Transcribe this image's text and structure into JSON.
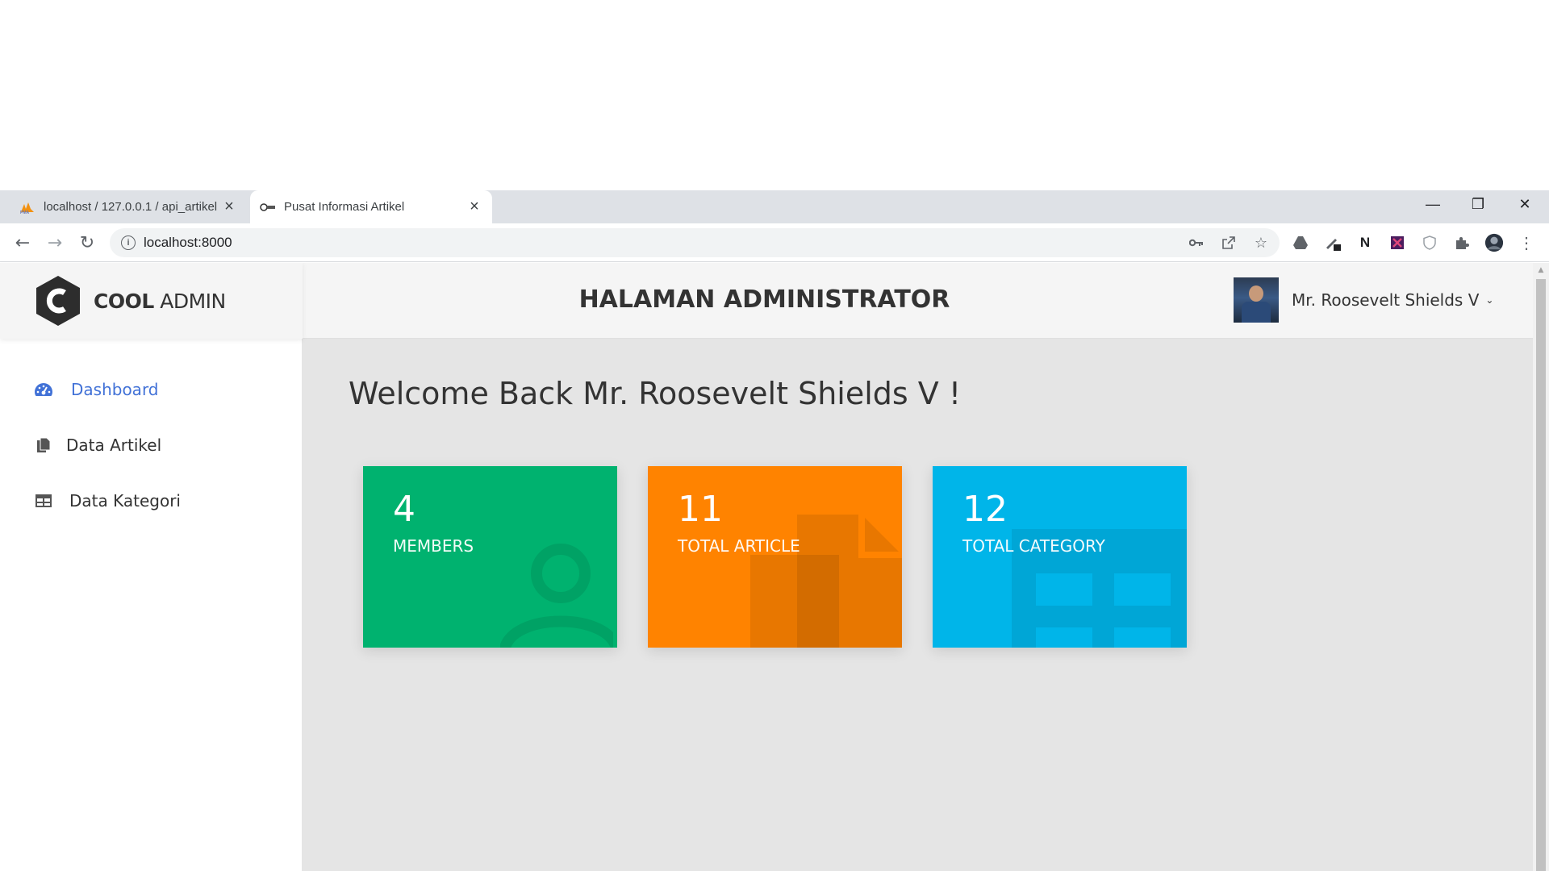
{
  "browser": {
    "tabs": [
      {
        "label": "localhost / 127.0.0.1 / api_artikel",
        "favicon": "phpmyadmin-icon",
        "active": false
      },
      {
        "label": "Pusat Informasi Artikel",
        "favicon": "site-favicon",
        "active": true
      }
    ],
    "new_tab": "+",
    "url": "localhost:8000"
  },
  "app": {
    "logo": {
      "bold": "COOL",
      "light": "ADMIN",
      "mark": "C"
    },
    "sidebar": [
      {
        "label": "Dashboard",
        "icon": "tachometer-icon",
        "active": true
      },
      {
        "label": "Data Artikel",
        "icon": "copy-icon",
        "active": false
      },
      {
        "label": "Data Kategori",
        "icon": "table-icon",
        "active": false
      }
    ],
    "header": {
      "title": "HALAMAN ADMINISTRATOR",
      "user_name": "Mr. Roosevelt Shields V"
    },
    "welcome": "Welcome Back Mr. Roosevelt Shields V !",
    "stats": [
      {
        "value": "4",
        "label": "MEMBERS",
        "color": "#00b26f",
        "icon": "user-icon"
      },
      {
        "value": "11",
        "label": "TOTAL ARTICLE",
        "color": "#ff8300",
        "icon": "copy-icon"
      },
      {
        "value": "12",
        "label": "TOTAL CATEGORY",
        "color": "#00b5e9",
        "icon": "table-icon"
      }
    ]
  },
  "colors": {
    "accent": "#4272d7",
    "text": "#333333"
  }
}
